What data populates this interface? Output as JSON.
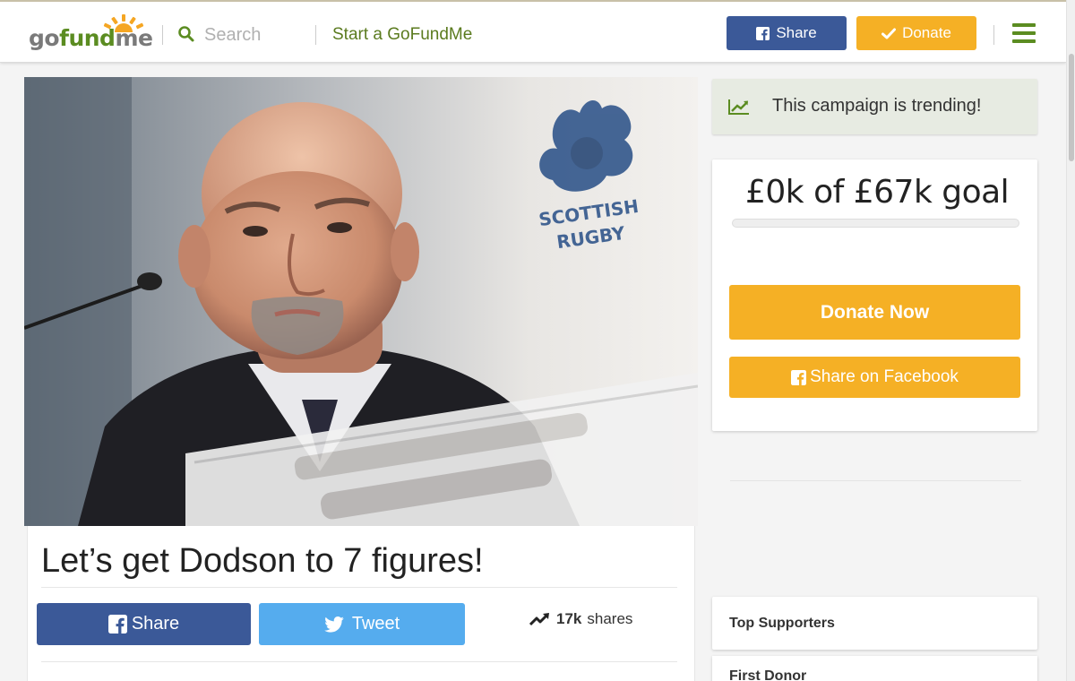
{
  "header": {
    "logo": {
      "go": "go",
      "fund": "fund",
      "me": "me"
    },
    "search_placeholder": "Search",
    "start_link": "Start a GoFundMe",
    "share_label": "Share",
    "donate_label": "Donate"
  },
  "campaign": {
    "title": "Let’s get Dodson to 7 figures!",
    "photo_sign_text": [
      "SCOTTISH",
      "RUGBY"
    ],
    "share_label": "Share",
    "tweet_label": "Tweet",
    "shares_count": "17k",
    "shares_label": "shares"
  },
  "sidebar": {
    "trending": "This campaign is trending!",
    "goal": "£0k of £67k goal",
    "progress_fraction": 0,
    "donate_now": "Donate Now",
    "share_facebook": "Share on Facebook",
    "top_supporters": "Top Supporters",
    "first_donor": "First Donor"
  },
  "colors": {
    "brand_green": "#5b8c21",
    "facebook_blue": "#3b5998",
    "twitter_blue": "#55acee",
    "donate_orange": "#f5b025",
    "trending_bg": "#e7ebe2"
  },
  "icons": [
    "search-icon",
    "facebook-icon",
    "check-icon",
    "hamburger-menu-icon",
    "twitter-icon",
    "trending-up-icon"
  ]
}
